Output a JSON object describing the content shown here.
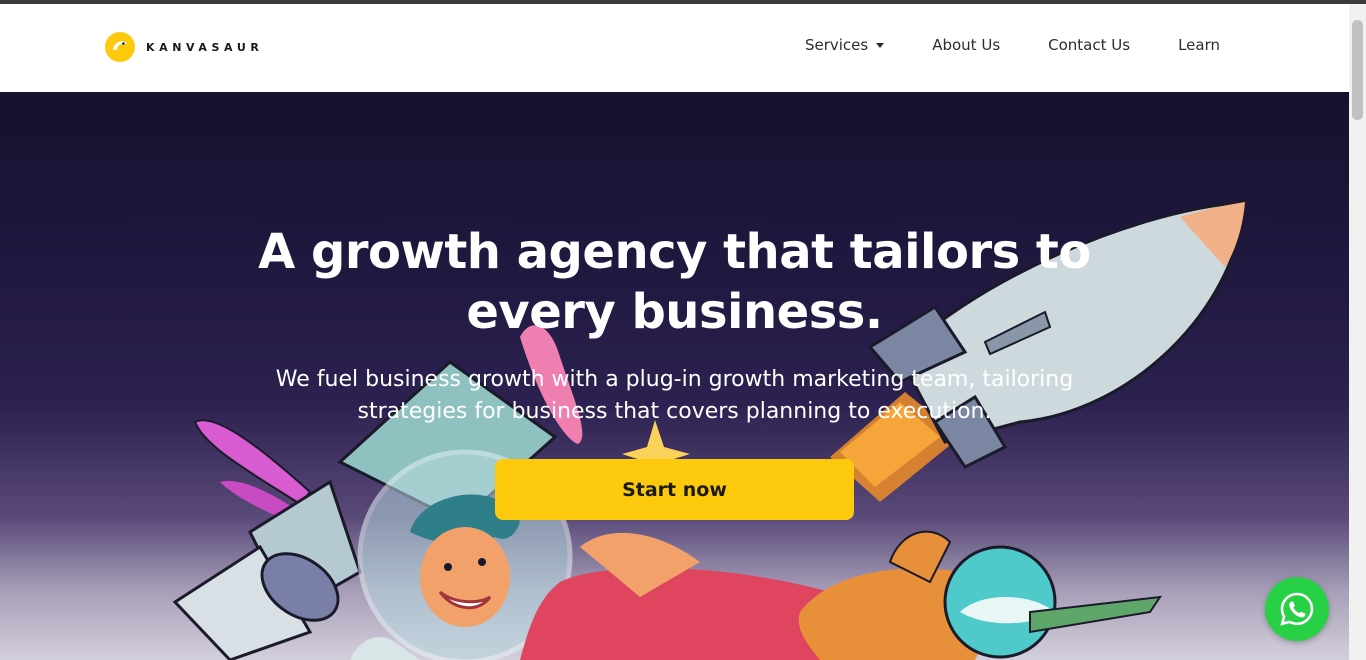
{
  "brand": {
    "name": "KANVASAUR",
    "color": "#fcc90c"
  },
  "nav": {
    "items": [
      {
        "label": "Services",
        "has_dropdown": true
      },
      {
        "label": "About Us",
        "has_dropdown": false
      },
      {
        "label": "Contact Us",
        "has_dropdown": false
      },
      {
        "label": "Learn",
        "has_dropdown": false
      }
    ]
  },
  "hero": {
    "title_line1": "A growth agency that tailors to",
    "title_line2": "every business.",
    "subtitle_line1": "We fuel business growth with a plug-in growth marketing team, tailoring",
    "subtitle_line2": "strategies for business that covers planning to execution.",
    "cta_label": "Start now",
    "cta_color": "#fcc90c"
  },
  "floating": {
    "whatsapp_icon": "whatsapp-icon",
    "whatsapp_color": "#27d045"
  }
}
